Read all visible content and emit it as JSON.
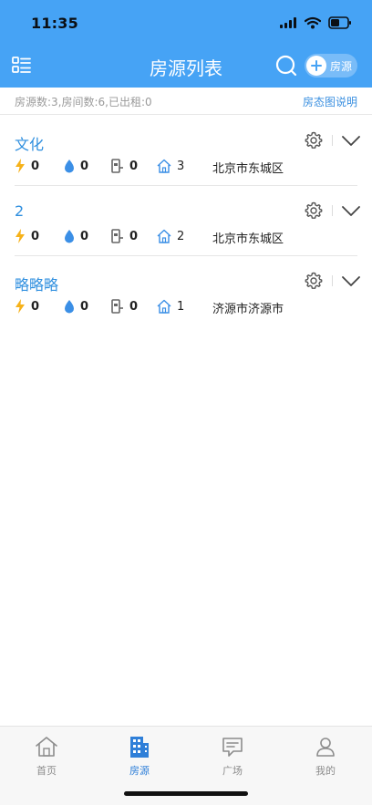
{
  "status_bar": {
    "time": "11:35"
  },
  "header": {
    "title": "房源列表",
    "add_button_label": "房源"
  },
  "summary": {
    "text": "房源数:3,房间数:6,已出租:0",
    "legend_link": "房态图说明"
  },
  "colors": {
    "brand_blue": "#46a3f5",
    "link_blue": "#2f8fdf",
    "power_yellow": "#f6b21a",
    "water_blue": "#3b8fe6"
  },
  "properties": [
    {
      "name": "文化",
      "power": "0",
      "water": "0",
      "lock": "0",
      "rooms": "3",
      "address": "北京市东城区"
    },
    {
      "name": "2",
      "power": "0",
      "water": "0",
      "lock": "0",
      "rooms": "2",
      "address": "北京市东城区"
    },
    {
      "name": "略略略",
      "power": "0",
      "water": "0",
      "lock": "0",
      "rooms": "1",
      "address": "济源市济源市"
    }
  ],
  "tabs": [
    {
      "label": "首页",
      "icon": "home-icon"
    },
    {
      "label": "房源",
      "icon": "building-icon"
    },
    {
      "label": "广场",
      "icon": "chat-icon"
    },
    {
      "label": "我的",
      "icon": "profile-icon"
    }
  ]
}
